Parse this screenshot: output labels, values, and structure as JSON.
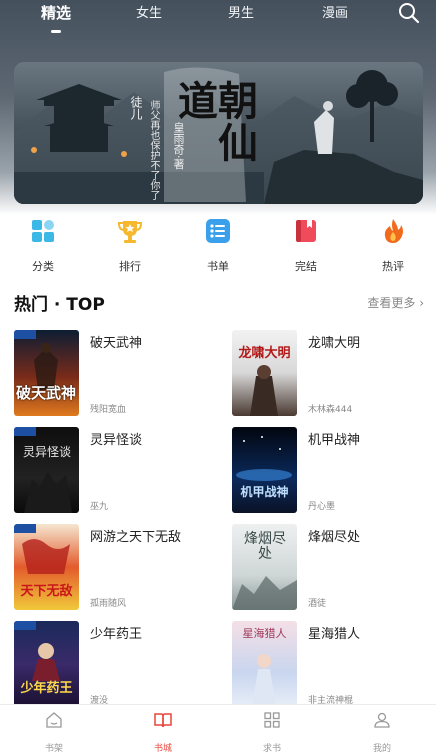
{
  "tabs": [
    {
      "label": "精选",
      "active": true
    },
    {
      "label": "女生",
      "active": false
    },
    {
      "label": "男生",
      "active": false
    },
    {
      "label": "漫画",
      "active": false
    }
  ],
  "banner": {
    "title": "朝仙道",
    "author": "皇雨奇·著",
    "tag": "徒儿",
    "quote": "师父再也保护不了你了"
  },
  "quicknav": [
    {
      "label": "分类",
      "icon": "grid-icon",
      "color": "#3cb8e6"
    },
    {
      "label": "排行",
      "icon": "trophy-icon",
      "color": "#f5b82e"
    },
    {
      "label": "书单",
      "icon": "list-icon",
      "color": "#3aa0ec"
    },
    {
      "label": "完结",
      "icon": "book-icon",
      "color": "#ef4b5a"
    },
    {
      "label": "热评",
      "icon": "flame-icon",
      "color": "#f26b1d"
    }
  ],
  "section": {
    "title": "热门 · TOP",
    "more": "查看更多 ›"
  },
  "books": [
    {
      "title": "破天武神",
      "author": "残阳宽血",
      "cover_text": "破天武神"
    },
    {
      "title": "龙啸大明",
      "author": "木林森444",
      "cover_text": "龙啸大明"
    },
    {
      "title": "灵异怪谈",
      "author": "巫九",
      "cover_text": "灵异怪谈"
    },
    {
      "title": "机甲战神",
      "author": "丹心墨",
      "cover_text": "机甲战神"
    },
    {
      "title": "网游之天下无敌",
      "author": "孤雨随风",
      "cover_text": "天下无敌"
    },
    {
      "title": "烽烟尽处",
      "author": "酒徒",
      "cover_text": "烽烟尽处"
    },
    {
      "title": "少年药王",
      "author": "渡没",
      "cover_text": "少年药王"
    },
    {
      "title": "星海猎人",
      "author": "非主流神棍",
      "cover_text": "星海猎人"
    }
  ],
  "bottomnav": [
    {
      "label": "书架",
      "icon": "home-icon",
      "active": false
    },
    {
      "label": "书城",
      "icon": "open-book-icon",
      "active": true
    },
    {
      "label": "求书",
      "icon": "apps-icon",
      "active": false
    },
    {
      "label": "我的",
      "icon": "user-icon",
      "active": false
    }
  ],
  "colors": {
    "accent": "#e8463a"
  }
}
